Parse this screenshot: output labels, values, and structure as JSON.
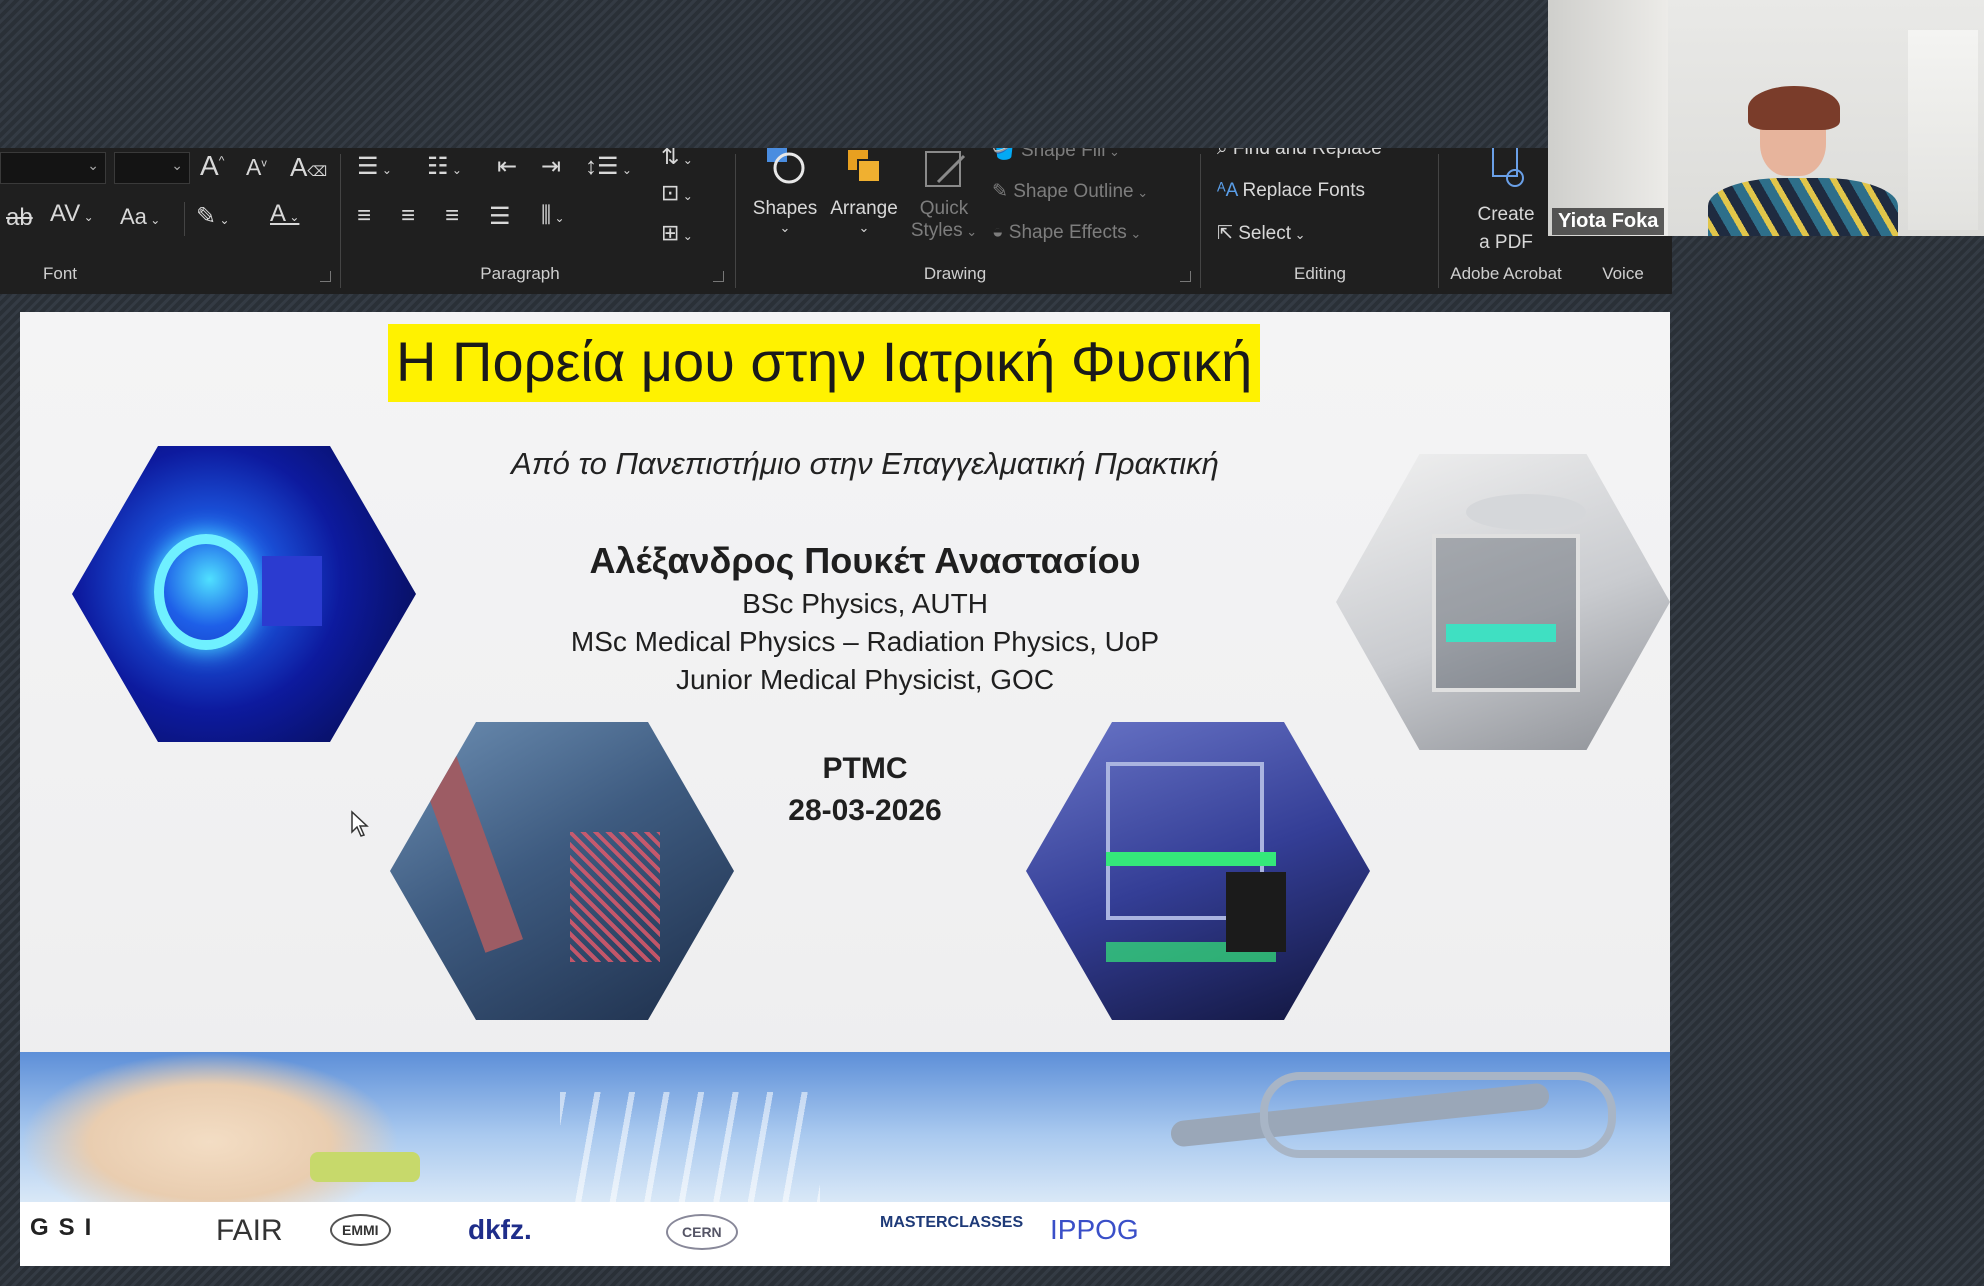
{
  "ribbon": {
    "groups": {
      "font": "Font",
      "paragraph": "Paragraph",
      "drawing": "Drawing",
      "editing": "Editing",
      "adobe": "Adobe Acrobat",
      "voice": "Voice"
    },
    "font_change_case": "Aa",
    "drawing": {
      "shapes": "Shapes",
      "arrange": "Arrange",
      "quick_styles_1": "Quick",
      "quick_styles_2": "Styles",
      "shape_fill": "Shape Fill",
      "shape_outline": "Shape Outline",
      "shape_effects": "Shape Effects"
    },
    "editing": {
      "find_replace": "Find and Replace",
      "replace_fonts": "Replace Fonts",
      "select": "Select"
    },
    "adobe": {
      "create_1": "Create",
      "create_2": "a PDF"
    }
  },
  "slide": {
    "title": "Η Πορεία μου στην Ιατρική Φυσική",
    "subtitle": "Από το Πανεπιστήμιο στην Επαγγελματική Πρακτική",
    "author": "Αλέξανδρος Πουκέτ Αναστασίου",
    "credentials": [
      "BSc Physics, AUTH",
      "MSc Medical Physics – Radiation Physics, UoP",
      "Junior Medical Physicist, GOC"
    ],
    "event": "PTMC",
    "date": "28-03-2026",
    "logos": [
      "GSI",
      "FAIR",
      "EMMI",
      "dkfz.",
      "CERN",
      "MASTERCLASSES",
      "IPPOG"
    ]
  },
  "webcam": {
    "participant_name": "Yiota Foka"
  },
  "colors": {
    "title_highlight": "#fff200",
    "ribbon_bg": "#1f1f1f",
    "slide_bg": "#f2f2f3"
  }
}
